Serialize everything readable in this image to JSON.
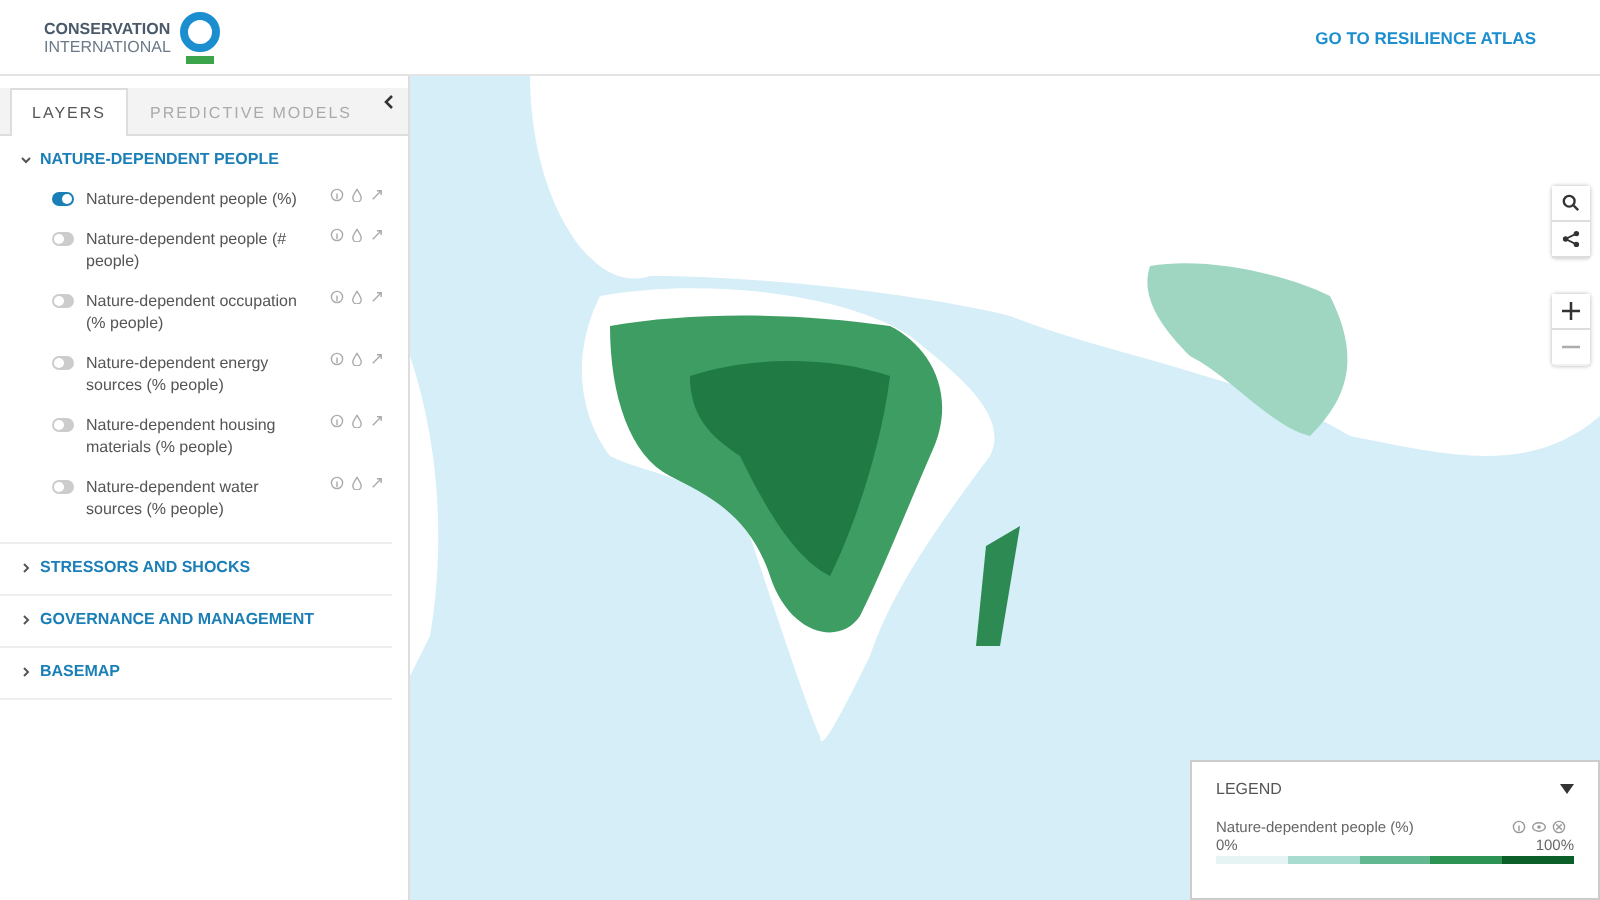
{
  "header": {
    "logo": {
      "line1": "CONSERVATION",
      "line2": "INTERNATIONAL"
    },
    "link": "GO TO RESILIENCE ATLAS"
  },
  "sidebar": {
    "tabs": [
      {
        "label": "LAYERS",
        "selected": true
      },
      {
        "label": "PREDICTIVE MODELS",
        "selected": false
      }
    ],
    "sections": [
      {
        "title": "NATURE-DEPENDENT PEOPLE",
        "expanded": true,
        "layers": [
          {
            "label": "Nature-dependent people (%)",
            "on": true
          },
          {
            "label": "Nature-dependent people (# people)",
            "on": false
          },
          {
            "label": "Nature-dependent occupation (% people)",
            "on": false
          },
          {
            "label": "Nature-dependent energy sources (% people)",
            "on": false
          },
          {
            "label": "Nature-dependent housing materials (% people)",
            "on": false
          },
          {
            "label": "Nature-dependent water sources (% people)",
            "on": false
          }
        ]
      },
      {
        "title": "STRESSORS AND SHOCKS",
        "expanded": false
      },
      {
        "title": "GOVERNANCE AND MANAGEMENT",
        "expanded": false
      },
      {
        "title": "BASEMAP",
        "expanded": false
      }
    ]
  },
  "legend": {
    "title": "LEGEND",
    "items": [
      {
        "label": "Nature-dependent people (%)",
        "min": "0%",
        "max": "100%"
      }
    ]
  }
}
